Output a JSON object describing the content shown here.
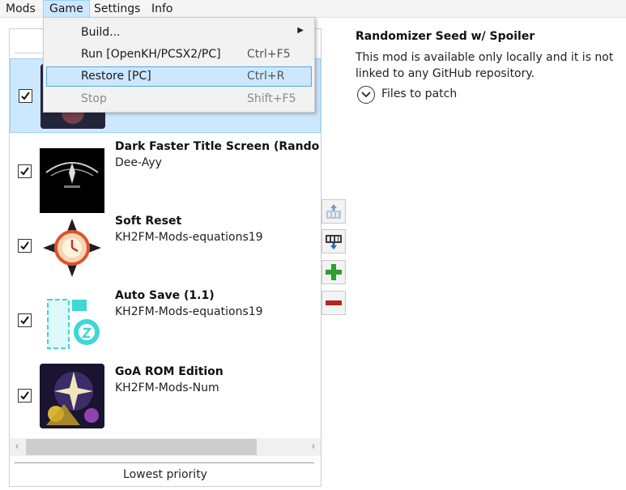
{
  "menu": [
    "Mods",
    "Game",
    "Settings",
    "Info"
  ],
  "game_menu": {
    "items": [
      {
        "label": "Build...",
        "shortcut": "",
        "has_submenu": true
      },
      {
        "label": "Run [OpenKH/PCSX2/PC]",
        "shortcut": "Ctrl+F5"
      },
      {
        "label": "Restore [PC]",
        "shortcut": "Ctrl+R",
        "highlighted": true
      },
      {
        "label": "Stop",
        "shortcut": "Shift+F5",
        "disabled": true
      }
    ]
  },
  "mods": [
    {
      "title": "",
      "author": "",
      "checked": true,
      "selected": true
    },
    {
      "title": "Dark Faster Title Screen (Rando Theme)",
      "author": "Dee-Ayy",
      "checked": true
    },
    {
      "title": "Soft Reset",
      "author": "KH2FM-Mods-equations19",
      "checked": true
    },
    {
      "title": "Auto Save (1.1)",
      "author": "KH2FM-Mods-equations19",
      "checked": true
    },
    {
      "title": "GoA ROM Edition",
      "author": "KH2FM-Mods-Num",
      "checked": true
    }
  ],
  "list_footer": "Lowest priority",
  "side_buttons": [
    "move-up-icon",
    "move-down-icon",
    "add-icon",
    "remove-icon"
  ],
  "details": {
    "title": "Randomizer Seed w/ Spoiler",
    "description": "This mod is available only locally and it is not linked to any GitHub repository.",
    "files_button": "Files to patch"
  },
  "colors": {
    "selection": "#cce8ff",
    "selection_border": "#99d1ff",
    "add_green": "#2e9e2e",
    "remove_red": "#b3261e"
  }
}
